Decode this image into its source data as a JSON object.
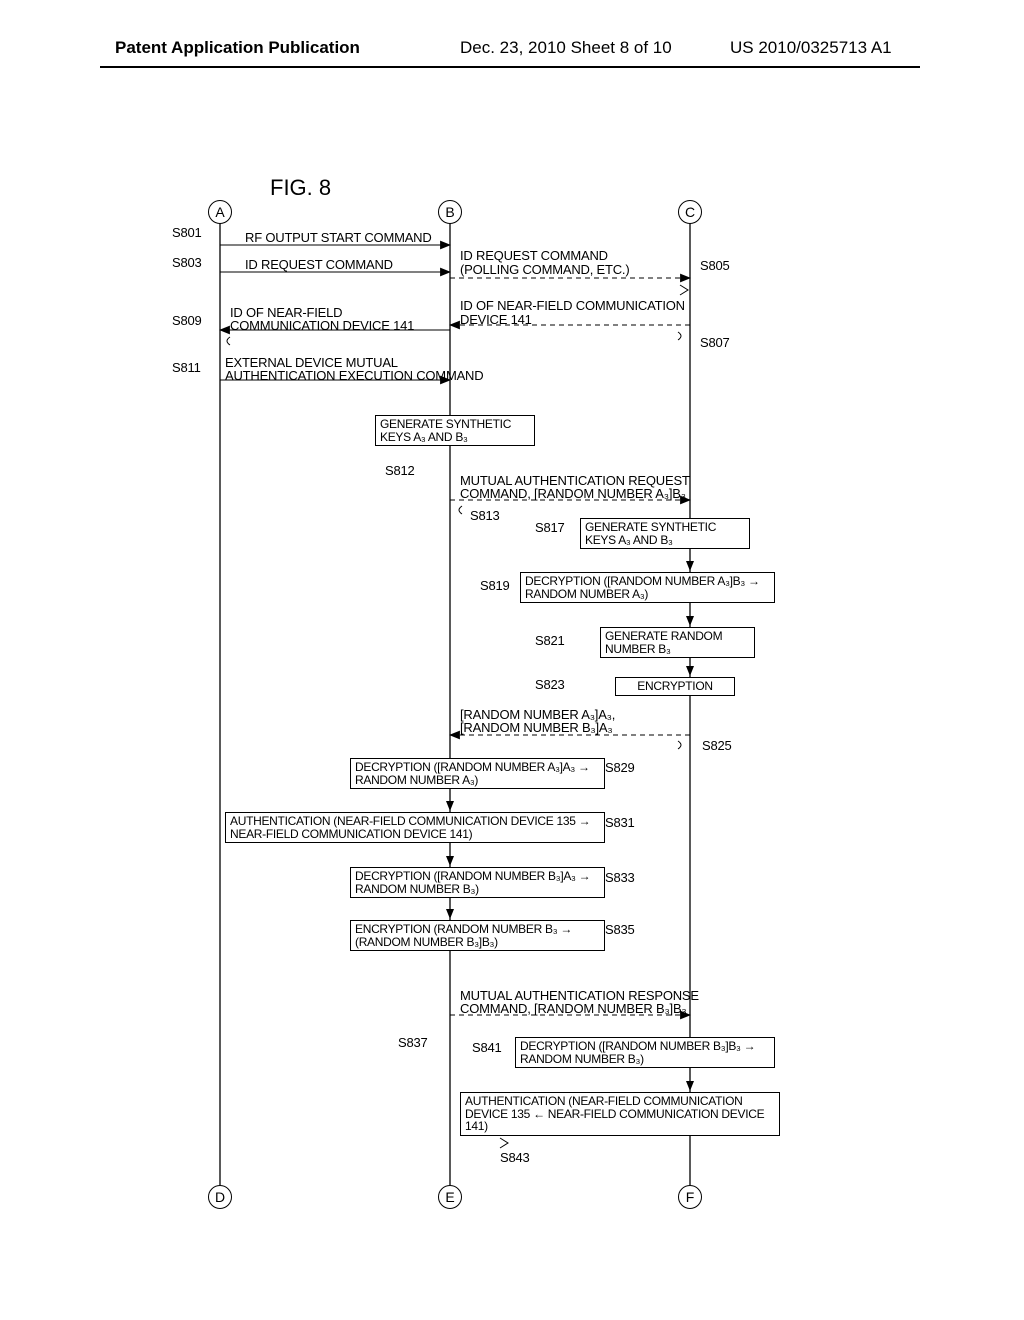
{
  "header": {
    "left": "Patent Application Publication",
    "center": "Dec. 23, 2010  Sheet 8 of 10",
    "right": "US 2010/0325713 A1"
  },
  "figure_label": "FIG. 8",
  "lane_labels": {
    "A": "A",
    "B": "B",
    "C": "C",
    "D": "D",
    "E": "E",
    "F": "F"
  },
  "steps": {
    "S801": "S801",
    "S803": "S803",
    "S805": "S805",
    "S807": "S807",
    "S809": "S809",
    "S811": "S811",
    "S812": "S812",
    "S813": "S813",
    "S817": "S817",
    "S819": "S819",
    "S821": "S821",
    "S823": "S823",
    "S825": "S825",
    "S829": "S829",
    "S831": "S831",
    "S833": "S833",
    "S835": "S835",
    "S837": "S837",
    "S841": "S841",
    "S843": "S843"
  },
  "messages": {
    "rf_output": "RF OUTPUT START COMMAND",
    "id_req_ab": "ID REQUEST COMMAND",
    "id_req_bc_l1": "ID REQUEST COMMAND",
    "id_req_bc_l2": "(POLLING COMMAND, ETC.)",
    "id_of_141_cb_l1": "ID OF NEAR-FIELD COMMUNICATION",
    "id_of_141_cb_l2": "DEVICE 141",
    "id_of_141_ba_l1": "ID OF NEAR-FIELD",
    "id_of_141_ba_l2": "COMMUNICATION DEVICE 141",
    "ext_auth_l1": "EXTERNAL DEVICE MUTUAL",
    "ext_auth_l2": "AUTHENTICATION EXECUTION COMMAND",
    "mutual_req_l1": "MUTUAL AUTHENTICATION REQUEST",
    "mutual_req_l2": "COMMAND, [RANDOM NUMBER A₃]B₃",
    "rand_pair_l1": "[RANDOM NUMBER A₃]A₃,",
    "rand_pair_l2": "[RANDOM NUMBER B₃]A₃",
    "mutual_resp_l1": "MUTUAL AUTHENTICATION RESPONSE",
    "mutual_resp_l2": "COMMAND, [RANDOM NUMBER B₃]B₃"
  },
  "boxes": {
    "gen_keys_B": "GENERATE SYNTHETIC\nKEYS A₃ AND B₃",
    "gen_keys_C": "GENERATE SYNTHETIC\nKEYS A₃ AND B₃",
    "dec_C_A": "DECRYPTION ([RANDOM NUMBER A₃]B₃ →\nRANDOM NUMBER A₃)",
    "gen_rand_B3": "GENERATE RANDOM\nNUMBER B₃",
    "enc_C": "ENCRYPTION",
    "dec_B_A": "DECRYPTION ([RANDOM NUMBER A₃]A₃ →\nRANDOM NUMBER A₃)",
    "auth_B_fwd": "AUTHENTICATION (NEAR-FIELD COMMUNICATION DEVICE 135 →\nNEAR-FIELD COMMUNICATION DEVICE 141)",
    "dec_B_B": "DECRYPTION ([RANDOM NUMBER B₃]A₃ →\nRANDOM NUMBER B₃)",
    "enc_B": "ENCRYPTION (RANDOM NUMBER B₃ →\n(RANDOM NUMBER B₃]B₃)",
    "dec_C_B": "DECRYPTION ([RANDOM NUMBER B₃]B₃ →\nRANDOM NUMBER B₃)",
    "auth_C_rev": "AUTHENTICATION (NEAR-FIELD COMMUNICATION\nDEVICE 135 ← NEAR-FIELD COMMUNICATION DEVICE 141)"
  }
}
